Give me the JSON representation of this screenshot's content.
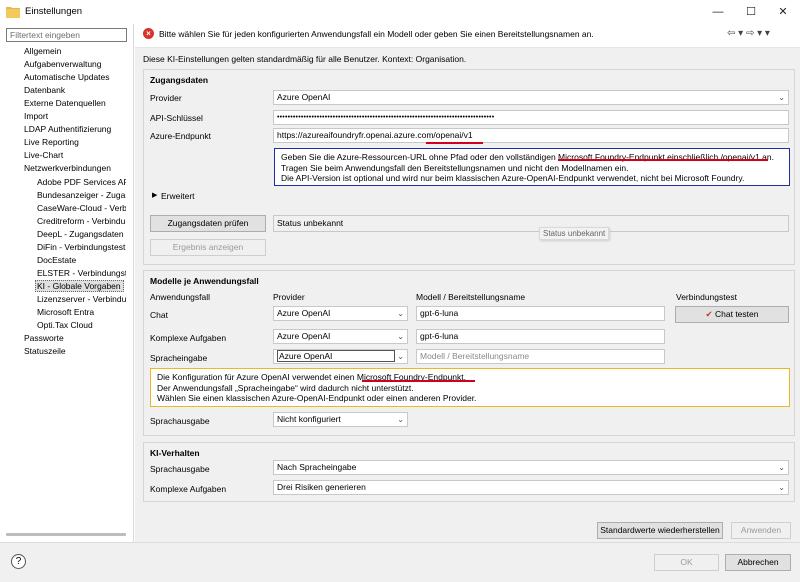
{
  "window": {
    "title": "Einstellungen",
    "minimize": "—",
    "maximize": "☐",
    "close": "✕"
  },
  "sidebar": {
    "filter_placeholder": "Filtertext eingeben",
    "items": [
      "Allgemein",
      "Aufgabenverwaltung",
      "Automatische Updates",
      "Datenbank",
      "Externe Datenquellen",
      "Import",
      "LDAP Authentifizierung",
      "Live Reporting",
      "Live-Chart",
      "Netzwerkverbindungen",
      "Adobe PDF Services AP",
      "Bundesanzeiger - Zugai",
      "CaseWare-Cloud - Verb",
      "Creditreform - Verbindu",
      "DeepL - Zugangsdaten",
      "DiFin - Verbindungstest",
      "DocEstate",
      "ELSTER - Verbindungste",
      "KI - Globale Vorgaben",
      "Lizenzserver - Verbindu",
      "Microsoft Entra",
      "Opti.Tax Cloud",
      "Passworte",
      "Statuszeile"
    ]
  },
  "message": {
    "error_icon": "×",
    "text": "Bitte wählen Sie für jeden konfigurierten Anwendungsfall ein Modell oder geben Sie einen Bereitstellungsnamen an.",
    "nav_icons": "⇦ ▾  ⇨ ▾  ▾"
  },
  "subtitle": "Diese KI-Einstellungen gelten standardmäßig für alle Benutzer. Kontext: Organisation.",
  "access": {
    "title": "Zugangsdaten",
    "provider_label": "Provider",
    "provider_value": "Azure OpenAI",
    "api_label": "API-Schlüssel",
    "api_value": "••••••••••••••••••••••••••••••••••••••••••••••••••••••••••••••••••••••••••••••••••",
    "endpoint_label": "Azure-Endpunkt",
    "endpoint_value": "https://azureaifoundryfr.openai.azure.com/openai/v1",
    "info_lines": [
      "Geben Sie die Azure-Ressourcen-URL ohne Pfad oder den vollständigen Microsoft Foundry-Endpunkt einschließlich /openai/v1 an.",
      "Tragen Sie beim Anwendungsfall den Bereitstellungsnamen und nicht den Modellnamen ein.",
      "Die API-Version ist optional und wird nur beim klassischen Azure-OpenAI-Endpunkt verwendet, nicht bei Microsoft Foundry."
    ],
    "advanced_label": "Erweitert",
    "check_button": "Zugangsdaten prüfen",
    "status_text": "Status unbekannt",
    "result_button": "Ergebnis anzeigen",
    "tooltip": "Status unbekannt"
  },
  "models": {
    "title": "Modelle je Anwendungsfall",
    "col_usecase": "Anwendungsfall",
    "col_provider": "Provider",
    "col_model": "Modell / Bereitstellungsname",
    "col_test": "Verbindungstest",
    "rows": [
      {
        "usecase": "Chat",
        "provider": "Azure OpenAI",
        "model": "gpt-6-luna",
        "placeholder": ""
      },
      {
        "usecase": "Komplexe Aufgaben",
        "provider": "Azure OpenAI",
        "model": "gpt-6-luna",
        "placeholder": ""
      },
      {
        "usecase": "Spracheingabe",
        "provider": "Azure OpenAI",
        "model": "",
        "placeholder": "Modell / Bereitstellungsname"
      }
    ],
    "chat_test_button": "Chat testen",
    "warning_lines": [
      "Die Konfiguration für Azure OpenAI verwendet einen Microsoft Foundry-Endpunkt.",
      "Der Anwendungsfall „Spracheingabe“ wird dadurch nicht unterstützt.",
      "Wählen Sie einen klassischen Azure-OpenAI-Endpunkt oder einen anderen Provider."
    ],
    "speech_output_label": "Sprachausgabe",
    "speech_output_value": "Nicht konfiguriert"
  },
  "behavior": {
    "title": "KI-Verhalten",
    "speech_label": "Sprachausgabe",
    "speech_value": "Nach Spracheingabe",
    "complex_label": "Komplexe Aufgaben",
    "complex_value": "Drei Risiken generieren"
  },
  "buttons": {
    "restore": "Standardwerte wiederherstellen",
    "apply": "Anwenden",
    "ok": "OK",
    "cancel": "Abbrechen"
  },
  "colors": {
    "error": "#d9342b",
    "info_border": "#1f2f9e",
    "warning_border": "#e8b923",
    "annotation": "#d0021b"
  }
}
